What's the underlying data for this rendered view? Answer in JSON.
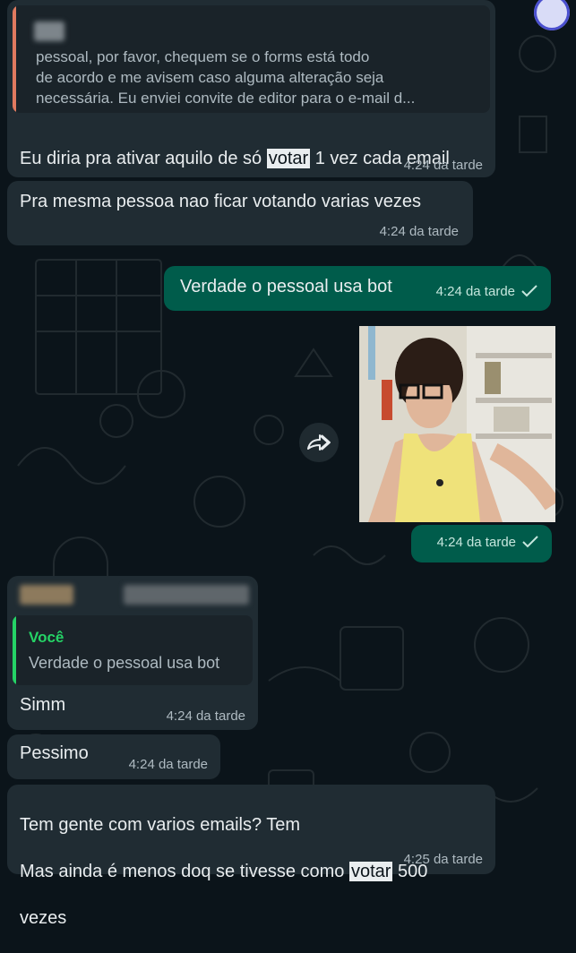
{
  "messages": {
    "m1": {
      "quote_text": "pessoal, por favor, chequem se o forms está todo\nde acordo e me avisem caso alguma alteração seja\nnecessária. Eu enviei convite de editor para o e-mail d...",
      "text_before": "Eu diria pra ativar aquilo de só ",
      "highlight": "votar",
      "text_after": " 1 vez cada email",
      "time": "4:24 da tarde"
    },
    "m2": {
      "text": "Pra mesma pessoa nao ficar votando varias vezes",
      "time": "4:24 da tarde"
    },
    "m3": {
      "text": "Verdade o pessoal usa bot",
      "time": "4:24 da tarde"
    },
    "m4": {
      "time": "4:24 da tarde"
    },
    "m5": {
      "quote_author": "Você",
      "quote_text": "Verdade o pessoal usa bot",
      "text": "Simm",
      "time": "4:24 da tarde"
    },
    "m6": {
      "text": "Pessimo",
      "time": "4:24 da tarde"
    },
    "m7": {
      "line1": "Tem gente com varios emails? Tem",
      "line2_before": "Mas ainda é menos doq se tivesse como ",
      "highlight": "votar",
      "line2_after": " 500",
      "line3": "vezes",
      "time": "4:25 da tarde"
    }
  },
  "colors": {
    "background": "#0b141a",
    "incoming_bubble": "#202c33",
    "outgoing_bubble": "#005c4b",
    "quote_bar_other": "#e07a5f",
    "quote_bar_self": "#25d366",
    "quote_author_self": "#25d366"
  },
  "icons": [
    "check-icon",
    "forward-icon",
    "avatar-icon"
  ]
}
